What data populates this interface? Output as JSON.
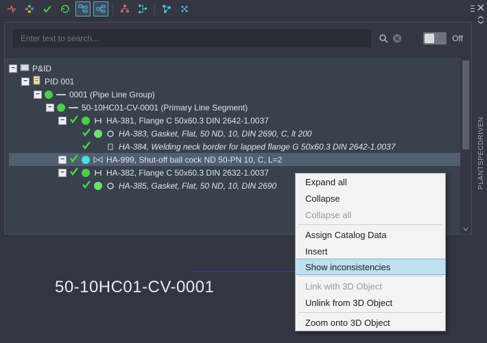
{
  "toolbar": {
    "hamburger_name": "panel-menu"
  },
  "search": {
    "placeholder": "Enter text to search...",
    "toggle_label": "Off"
  },
  "sidebar": {
    "vertical_label": "PLANTSPECDRIVEN"
  },
  "tree": {
    "root_label": "P&ID",
    "pid_label": "PID 001",
    "pipe_group": {
      "tag": "0001",
      "desc": "(Pipe Line Group)"
    },
    "primary_segment": {
      "tag": "50-10HC01-CV-0001",
      "desc": "(Primary Line Segment)"
    },
    "items": [
      {
        "label": "HA-381, Flange C 50x60.3 DIN 2642-1.0037",
        "italic": false,
        "dot": "g"
      },
      {
        "label": "HA-383, Gasket, Flat, 50 ND, 10, DIN 2690, C, lt 200",
        "italic": true,
        "dot": "lg"
      },
      {
        "label": "HA-384, Welding neck border for lapped flange G 50x60.3 DIN 2642-1.0037",
        "italic": true,
        "dot": ""
      },
      {
        "label": "HA-999, Shut-off ball cock ND 50-PN 10, C, L=2",
        "italic": false,
        "dot": "cy",
        "selected": true
      },
      {
        "label": "HA-382, Flange C 50x60.3 DIN 2632-1.0037",
        "italic": false,
        "dot": "g"
      },
      {
        "label": "HA-385, Gasket, Flat, 50 ND, 10, DIN 2690",
        "italic": true,
        "dot": "lg"
      }
    ]
  },
  "context_menu": {
    "items": [
      {
        "label": "Expand all",
        "enabled": true
      },
      {
        "label": "Collapse",
        "enabled": true
      },
      {
        "label": "Collapse all",
        "enabled": false
      },
      {
        "sep": true
      },
      {
        "label": "Assign Catalog Data",
        "enabled": true
      },
      {
        "label": "Insert",
        "enabled": true
      },
      {
        "label": "Show inconsistencies",
        "enabled": true,
        "highlight": true
      },
      {
        "sep": true
      },
      {
        "label": "Link with 3D Object",
        "enabled": false
      },
      {
        "label": "Unlink from 3D Object",
        "enabled": true
      },
      {
        "sep": true
      },
      {
        "label": "Zoom onto 3D Object",
        "enabled": true
      }
    ]
  },
  "canvas": {
    "big_label": "50-10HC01-CV-0001"
  }
}
